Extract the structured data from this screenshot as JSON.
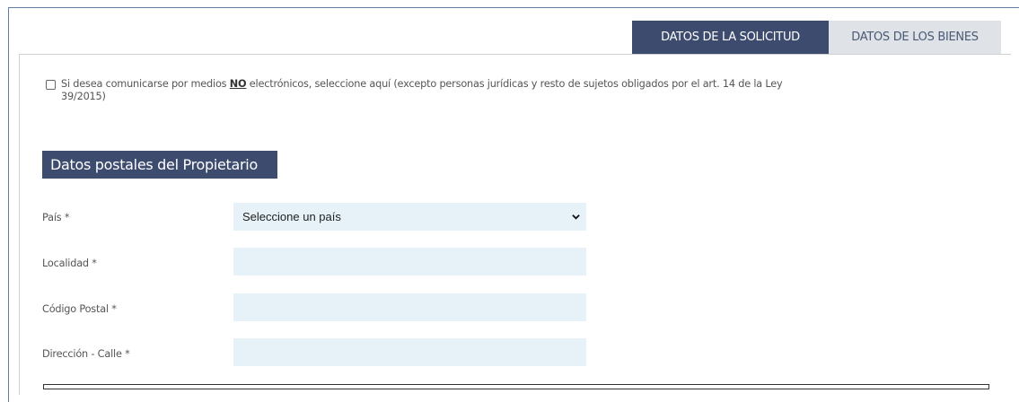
{
  "tabs": [
    {
      "label": "DATOS DE LA SOLICITUD",
      "active": true
    },
    {
      "label": "DATOS DE LOS BIENES",
      "active": false
    }
  ],
  "notice": {
    "part1": "Si desea comunicarse por medios ",
    "emphasis": "NO",
    "part2": " electrónicos, seleccione aquí (excepto personas jurídicas y resto de sujetos obligados por el art. 14 de la Ley 39/2015)",
    "checked": false
  },
  "section": {
    "title": "Datos postales del Propietario"
  },
  "fields": {
    "pais": {
      "label": "País *",
      "value": "Seleccione un país"
    },
    "localidad": {
      "label": "Localidad *",
      "value": ""
    },
    "codigo_postal": {
      "label": "Código Postal *",
      "value": ""
    },
    "direccion": {
      "label": "Dirección - Calle *",
      "value": ""
    }
  },
  "colors": {
    "accent": "#3c4b6e",
    "tab_inactive": "#dfe2e6",
    "input_bg": "#e6f2f7",
    "frame_border": "#5f7ea3"
  },
  "icons": {
    "select_arrow": "chevron-down-icon",
    "checkbox": "checkbox-icon"
  }
}
